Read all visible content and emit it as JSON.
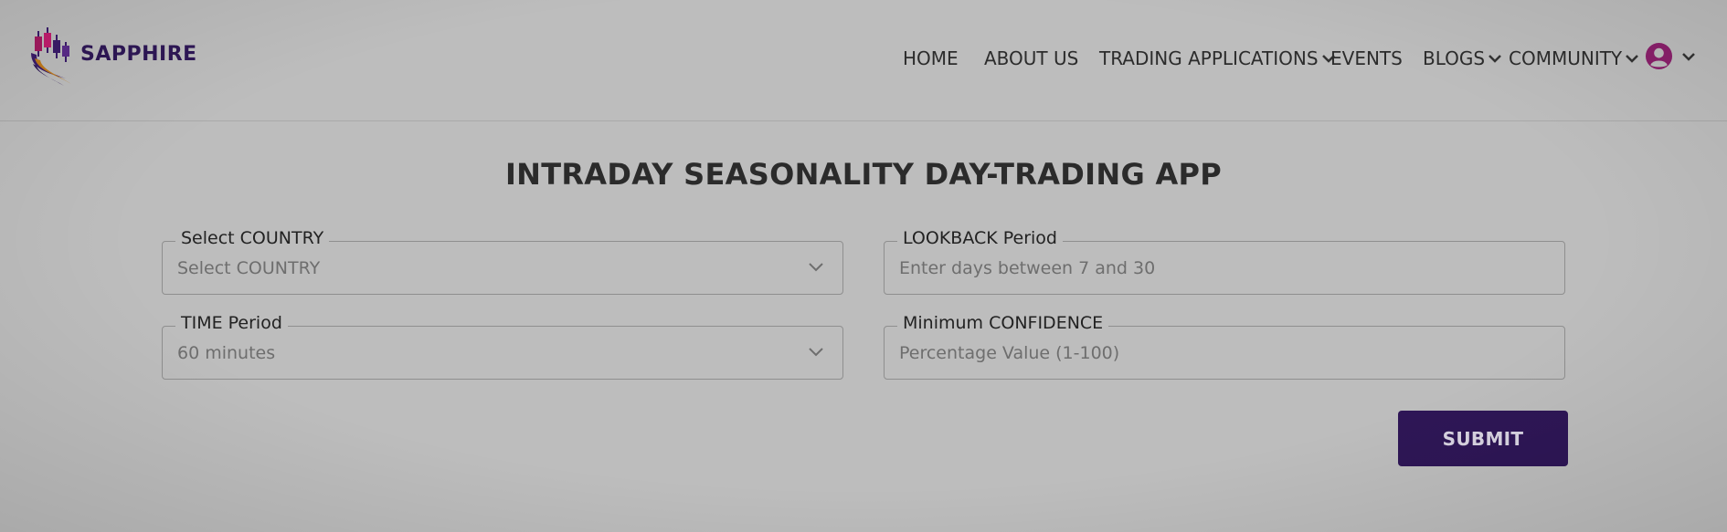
{
  "brand": {
    "name": "SAPPHIRE",
    "color": "#2e1756"
  },
  "nav": {
    "items": [
      {
        "label": "HOME",
        "dropdown": false
      },
      {
        "label": "ABOUT US",
        "dropdown": false
      },
      {
        "label": "TRADING APPLICATIONS",
        "dropdown": true
      },
      {
        "label": "EVENTS",
        "dropdown": false
      },
      {
        "label": "BLOGS",
        "dropdown": true
      },
      {
        "label": "COMMUNITY",
        "dropdown": true
      }
    ],
    "user_icon": "user-circle-icon"
  },
  "main": {
    "title": "INTRADAY SEASONALITY DAY-TRADING APP",
    "fields": {
      "country": {
        "label": "Select COUNTRY",
        "placeholder": "Select COUNTRY",
        "type": "select"
      },
      "lookback": {
        "label": "LOOKBACK Period",
        "placeholder": "Enter days between 7 and 30",
        "type": "input"
      },
      "time": {
        "label": "TIME Period",
        "value": "60 minutes",
        "type": "select"
      },
      "confidence": {
        "label": "Minimum CONFIDENCE",
        "placeholder": "Percentage Value (1-100)",
        "type": "input"
      }
    },
    "submit_label": "SUBMIT"
  },
  "colors": {
    "accent": "#2e1656",
    "avatar": "#8a1f6b",
    "background": "#bdbdbd"
  }
}
